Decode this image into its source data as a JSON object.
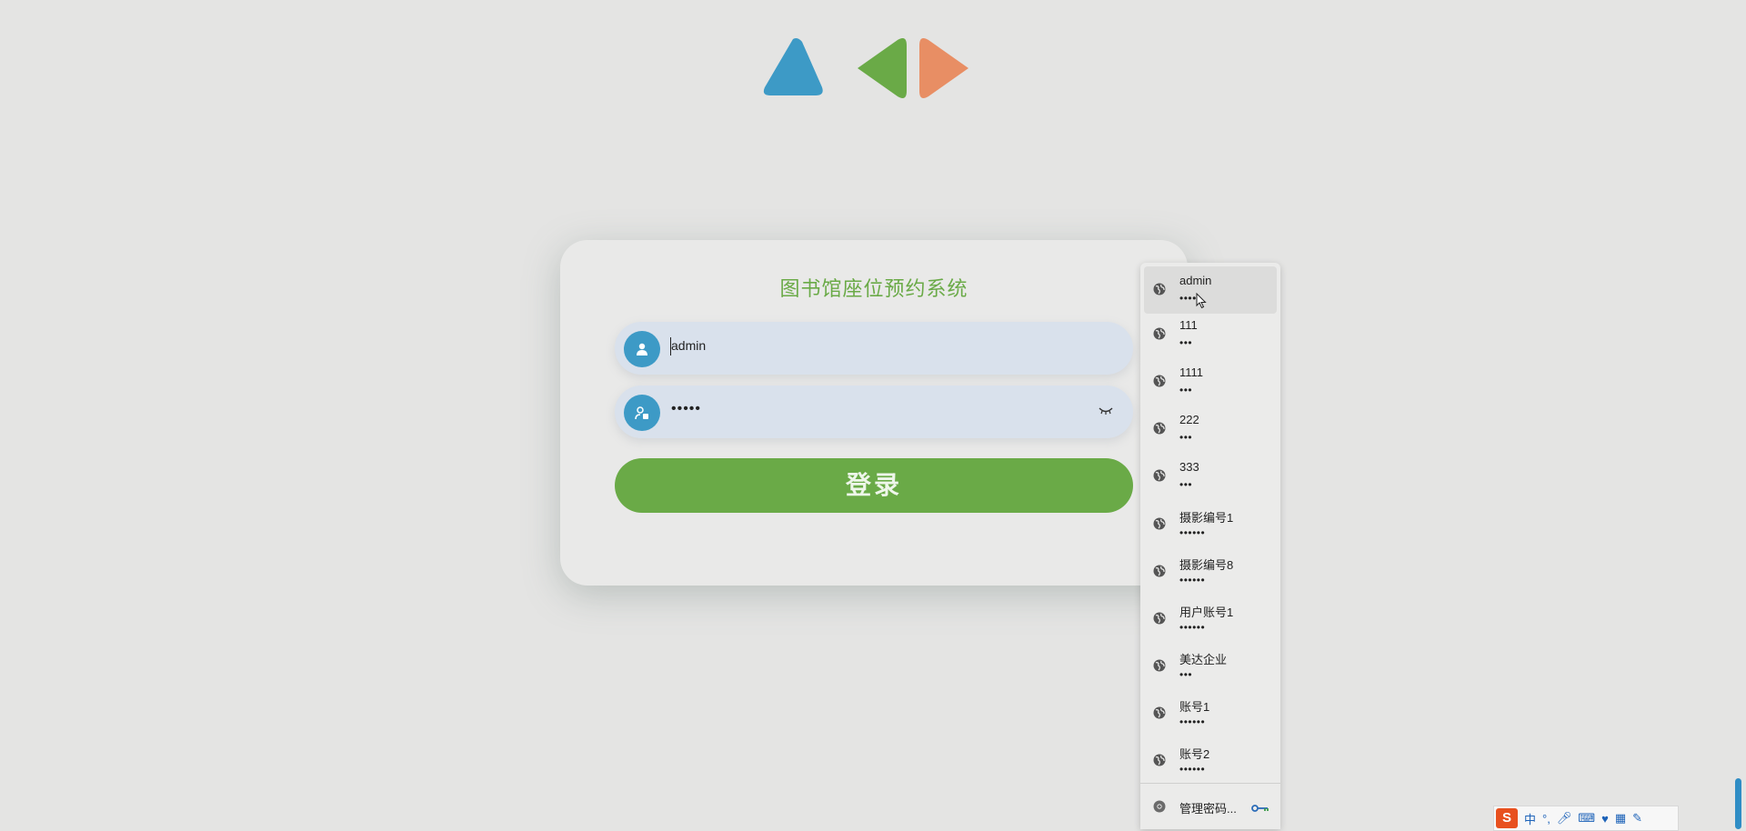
{
  "app": {
    "title": "图书馆座位预约系统"
  },
  "login_form": {
    "username_value": "admin",
    "password_mask": "•••••",
    "eye_icon": "eye-closed-icon",
    "submit_label": "登录"
  },
  "autofill": {
    "items": [
      {
        "username": "admin",
        "password_mask": "••••"
      },
      {
        "username": "111",
        "password_mask": "•••"
      },
      {
        "username": "1111",
        "password_mask": "•••"
      },
      {
        "username": "222",
        "password_mask": "•••"
      },
      {
        "username": "333",
        "password_mask": "•••"
      },
      {
        "username": "摄影编号1",
        "password_mask": "••••••"
      },
      {
        "username": "摄影编号8",
        "password_mask": "••••••"
      },
      {
        "username": "用户账号1",
        "password_mask": "••••••"
      },
      {
        "username": "美达企业",
        "password_mask": "•••"
      },
      {
        "username": "账号1",
        "password_mask": "••••••"
      },
      {
        "username": "账号2",
        "password_mask": "••••••"
      }
    ],
    "manage_label": "管理密码..."
  },
  "ime": {
    "brand": "S",
    "mode": "中",
    "punct": "°,"
  },
  "colors": {
    "accent_green": "#6aaa47",
    "accent_blue": "#3d9ac6",
    "accent_orange": "#e88e64"
  }
}
